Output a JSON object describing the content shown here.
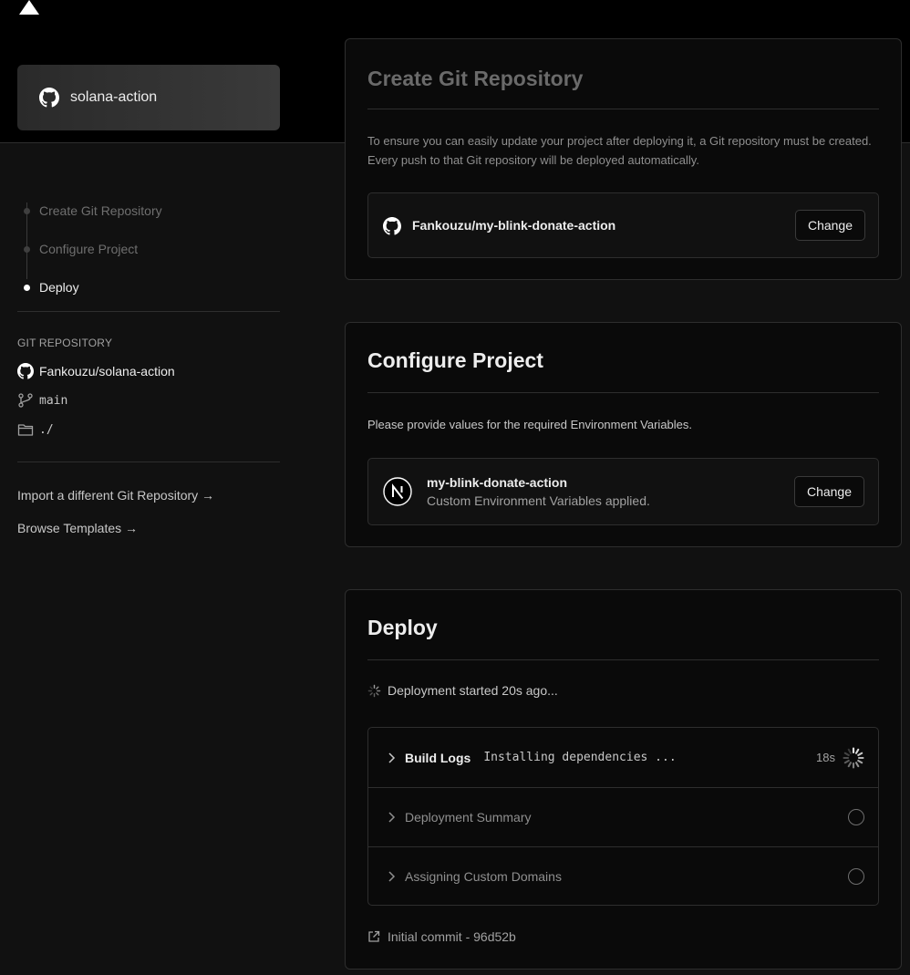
{
  "header": {
    "repo_name": "solana-action"
  },
  "steps": [
    {
      "label": "Create Git Repository",
      "state": "completed"
    },
    {
      "label": "Configure Project",
      "state": "completed"
    },
    {
      "label": "Deploy",
      "state": "active"
    }
  ],
  "git": {
    "heading": "GIT REPOSITORY",
    "repo": "Fankouzu/solana-action",
    "branch": "main",
    "root_dir": "./"
  },
  "links": {
    "import": "Import a different Git Repository →",
    "templates": "Browse Templates →"
  },
  "create_git": {
    "title": "Create Git Repository",
    "description": "To ensure you can easily update your project after deploying it, a Git repository must be created. Every push to that Git repository will be deployed automatically.",
    "repo": "Fankouzu/my-blink-donate-action",
    "change_label": "Change"
  },
  "configure": {
    "title": "Configure Project",
    "description": "Please provide values for the required Environment Variables.",
    "project_name": "my-blink-donate-action",
    "project_status": "Custom Environment Variables applied.",
    "change_label": "Change"
  },
  "deploy": {
    "title": "Deploy",
    "status": "Deployment started 20s ago...",
    "rows": [
      {
        "title": "Build Logs",
        "sub": "Installing dependencies ...",
        "time": "18s",
        "state": "running"
      },
      {
        "title": "Deployment Summary",
        "sub": "",
        "time": "",
        "state": "pending"
      },
      {
        "title": "Assigning Custom Domains",
        "sub": "",
        "time": "",
        "state": "pending"
      }
    ],
    "commit": "Initial commit - 96d52b"
  },
  "colors": {
    "background": "#111111",
    "top_band": "#000000",
    "card": "#0a0a0a",
    "border": "#2e2e2e",
    "text": "#ededed",
    "muted": "#8f8f8f"
  }
}
